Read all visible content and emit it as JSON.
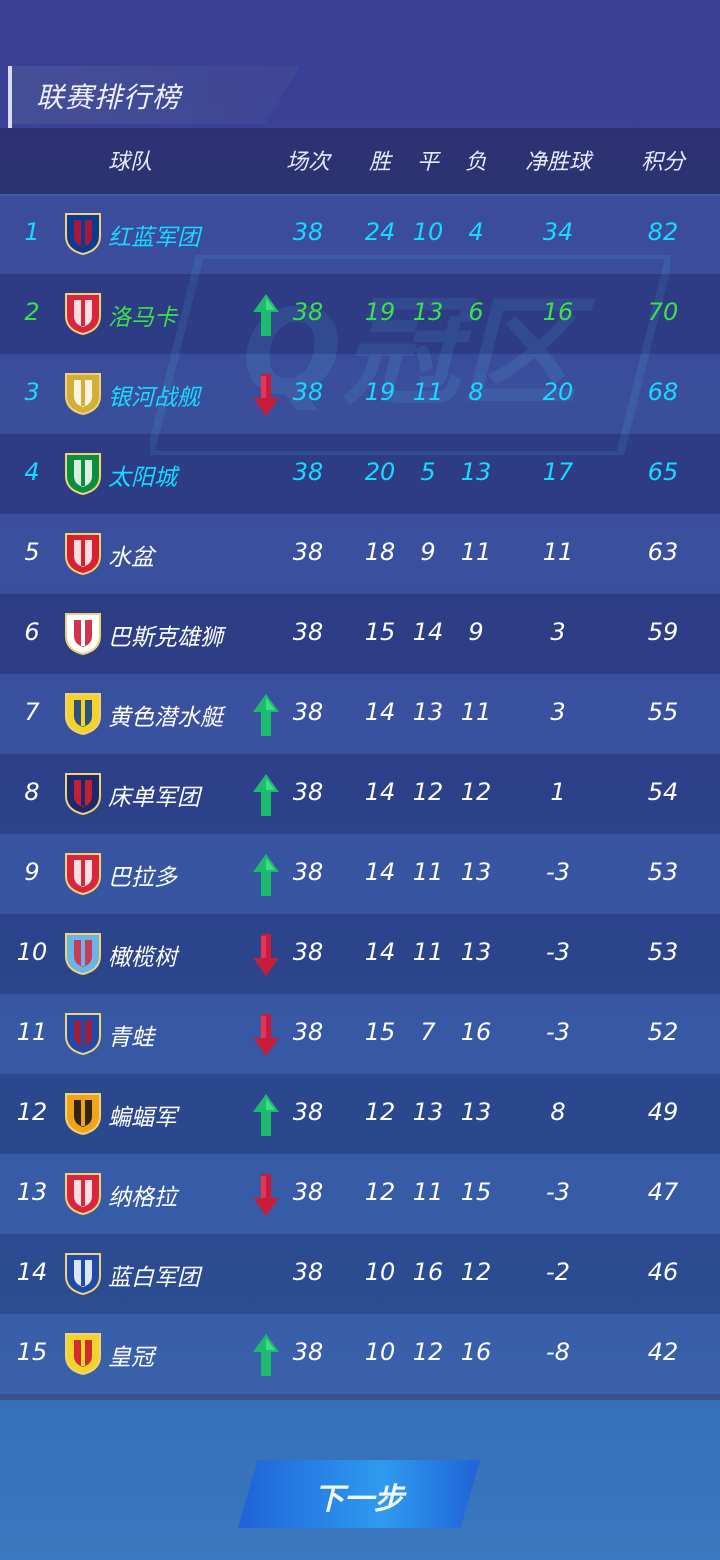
{
  "page": {
    "title": "联赛排行榜",
    "next_button_label": "下一步"
  },
  "header": {
    "team": "球队",
    "played": "场次",
    "win": "胜",
    "draw": "平",
    "loss": "负",
    "goal_diff": "净胜球",
    "points": "积分"
  },
  "colors": {
    "top_highlight": "#18d9ff",
    "second_highlight": "#39e14a",
    "normal_text": "#ffffff",
    "up_arrow": "#1dbb6e",
    "down_arrow": "#c81d3a"
  },
  "rows": [
    {
      "rank": "1",
      "name": "红蓝军团",
      "badge": "red-blue-shield-icon",
      "trend": "none",
      "played": "38",
      "win": "24",
      "draw": "10",
      "loss": "4",
      "gd": "34",
      "pts": "82"
    },
    {
      "rank": "2",
      "name": "洛马卡",
      "badge": "red-white-stripes-shield-icon",
      "trend": "up",
      "played": "38",
      "win": "19",
      "draw": "13",
      "loss": "6",
      "gd": "16",
      "pts": "70"
    },
    {
      "rank": "3",
      "name": "银河战舰",
      "badge": "crown-badge-icon",
      "trend": "down",
      "played": "38",
      "win": "19",
      "draw": "11",
      "loss": "8",
      "gd": "20",
      "pts": "68"
    },
    {
      "rank": "4",
      "name": "太阳城",
      "badge": "green-white-crest-icon",
      "trend": "none",
      "played": "38",
      "win": "20",
      "draw": "5",
      "loss": "13",
      "gd": "17",
      "pts": "65"
    },
    {
      "rank": "5",
      "name": "水盆",
      "badge": "red-round-crest-icon",
      "trend": "none",
      "played": "38",
      "win": "18",
      "draw": "9",
      "loss": "11",
      "gd": "11",
      "pts": "63"
    },
    {
      "rank": "6",
      "name": "巴斯克雄狮",
      "badge": "athletic-crest-icon",
      "trend": "none",
      "played": "38",
      "win": "15",
      "draw": "14",
      "loss": "9",
      "gd": "3",
      "pts": "59"
    },
    {
      "rank": "7",
      "name": "黄色潜水艇",
      "badge": "yellow-submarine-crest-icon",
      "trend": "up",
      "played": "38",
      "win": "14",
      "draw": "13",
      "loss": "11",
      "gd": "3",
      "pts": "55"
    },
    {
      "rank": "8",
      "name": "床单军团",
      "badge": "blue-red-hex-crest-icon",
      "trend": "up",
      "played": "38",
      "win": "14",
      "draw": "12",
      "loss": "12",
      "gd": "1",
      "pts": "54"
    },
    {
      "rank": "9",
      "name": "巴拉多",
      "badge": "red-white-crown-crest-icon",
      "trend": "up",
      "played": "38",
      "win": "14",
      "draw": "11",
      "loss": "13",
      "gd": "-3",
      "pts": "53"
    },
    {
      "rank": "10",
      "name": "橄榄树",
      "badge": "light-blue-cross-crest-icon",
      "trend": "down",
      "played": "38",
      "win": "14",
      "draw": "11",
      "loss": "13",
      "gd": "-3",
      "pts": "53"
    },
    {
      "rank": "11",
      "name": "青蛙",
      "badge": "levante-crest-icon",
      "trend": "down",
      "played": "38",
      "win": "15",
      "draw": "7",
      "loss": "16",
      "gd": "-3",
      "pts": "52"
    },
    {
      "rank": "12",
      "name": "蝙蝠军",
      "badge": "bat-crest-icon",
      "trend": "up",
      "played": "38",
      "win": "12",
      "draw": "13",
      "loss": "13",
      "gd": "8",
      "pts": "49"
    },
    {
      "rank": "13",
      "name": "纳格拉",
      "badge": "red-monogram-crest-icon",
      "trend": "down",
      "played": "38",
      "win": "12",
      "draw": "11",
      "loss": "15",
      "gd": "-3",
      "pts": "47"
    },
    {
      "rank": "14",
      "name": "蓝白军团",
      "badge": "blue-white-stripe-crest-icon",
      "trend": "none",
      "played": "38",
      "win": "10",
      "draw": "16",
      "loss": "12",
      "gd": "-2",
      "pts": "46"
    },
    {
      "rank": "15",
      "name": "皇冠",
      "badge": "yellow-red-crest-icon",
      "trend": "up",
      "played": "38",
      "win": "10",
      "draw": "12",
      "loss": "16",
      "gd": "-8",
      "pts": "42"
    }
  ]
}
